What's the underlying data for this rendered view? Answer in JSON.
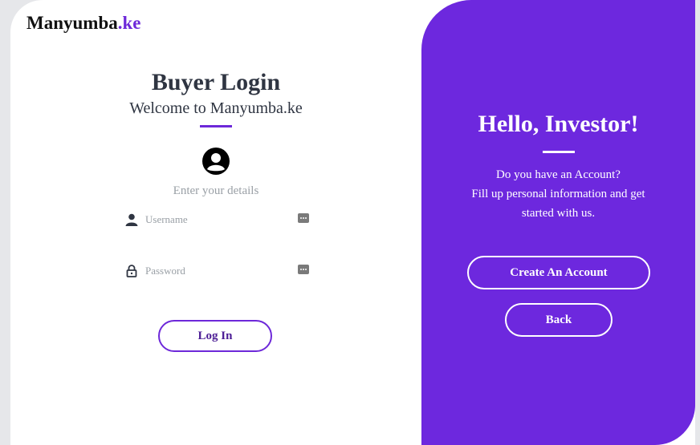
{
  "brand": {
    "name": "Manyumba",
    "suffix": ".ke"
  },
  "login": {
    "title": "Buyer Login",
    "subtitle": "Welcome to Manyumba.ke",
    "hint": "Enter your details",
    "username_placeholder": "Username",
    "password_placeholder": "Password",
    "login_label": "Log In"
  },
  "side": {
    "title": "Hello, Investor!",
    "line1": "Do you have an Account?",
    "line2": "Fill up personal information and get",
    "line3": "started with us.",
    "create_label": "Create An Account",
    "back_label": "Back"
  },
  "colors": {
    "accent": "#6d28de",
    "text": "#2f3542",
    "muted": "#9aa0a6"
  },
  "icons": {
    "avatar": "user-circle-icon",
    "username": "person-icon",
    "password": "lock-icon",
    "autofill": "password-manager-key-icon"
  }
}
